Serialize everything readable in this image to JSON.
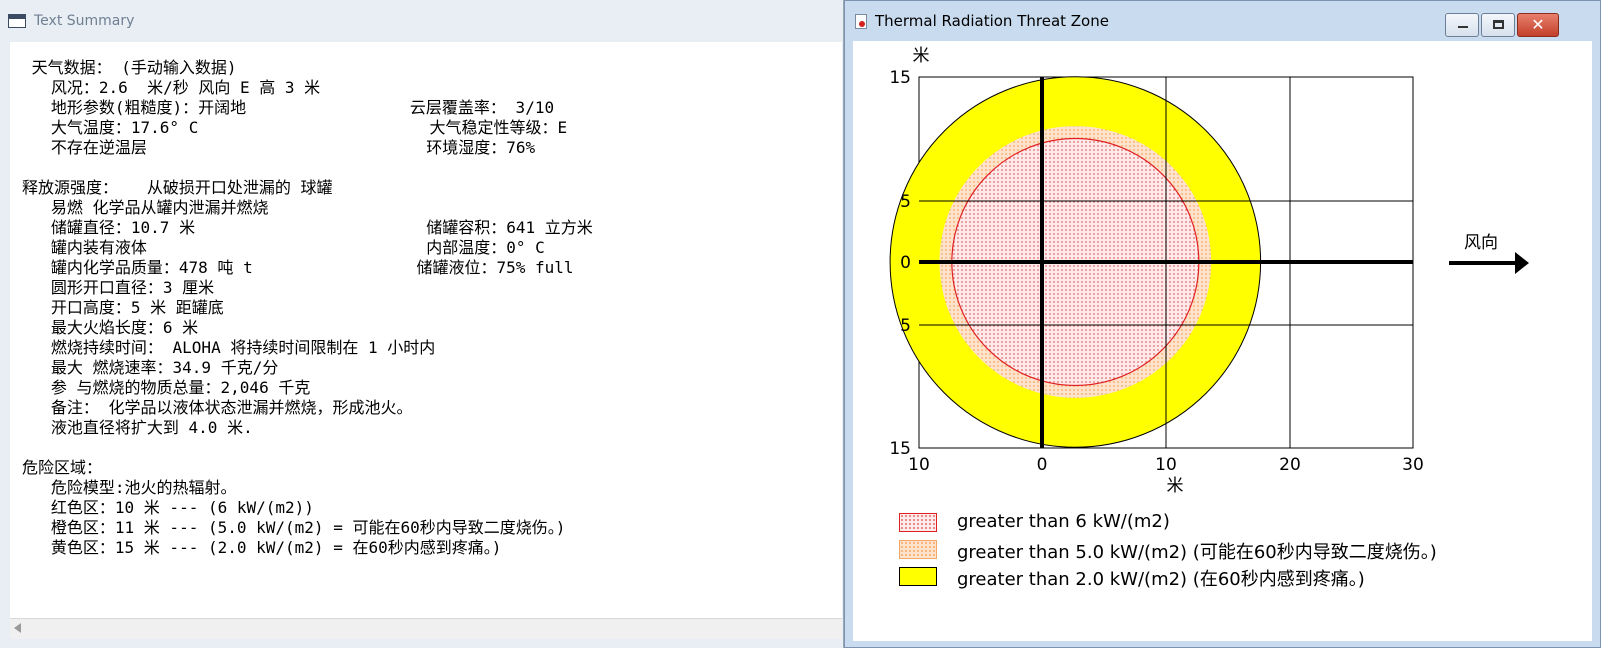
{
  "summary_window": {
    "title": "Text Summary",
    "text": " 天气数据： (手动输入数据)\n   风况：2.6  米/秒 风向 E 高 3 米\n   地形参数(粗糙度)：开阔地                 云层覆盖率： 3/10\n   大气温度：17.6° C                        大气稳定性等级：E\n   不存在逆温层                             环境湿度：76%\n\n释放源强度：   从破损开口处泄漏的 球罐\n   易燃 化学品从罐内泄漏并燃烧\n   储罐直径：10.7 米                        储罐容积：641 立方米\n   罐内装有液体                             内部温度：0° C\n   罐内化学品质量：478 吨 t                 储罐液位：75% full\n   圆形开口直径：3 厘米\n   开口高度：5 米 距罐底\n   最大火焰长度：6 米\n   燃烧持续时间： ALOHA 将持续时间限制在 1 小时内\n   最大 燃烧速率：34.9 千克/分\n   参 与燃烧的物质总量：2,046 千克\n   备注： 化学品以液体状态泄漏并燃烧，形成池火。\n   液池直径将扩大到 4.0 米.\n\n危险区域：\n   危险模型:池火的热辐射。\n   红色区：10 米 --- (6 kW/(m2))\n   橙色区：11 米 --- (5.0 kW/(m2) = 可能在60秒内导致二度烧伤。)\n   黄色区：15 米 --- (2.0 kW/(m2) = 在60秒内感到疼痛。)"
  },
  "threat_window": {
    "title": "Thermal Radiation Threat Zone",
    "buttons": {
      "close": "✕"
    }
  },
  "chart_data": {
    "type": "threat-zone",
    "x_ticks": [
      "10",
      "0",
      "10",
      "20",
      "30"
    ],
    "y_ticks": [
      "15",
      "5",
      "0",
      "5",
      "15"
    ],
    "x_unit": "米",
    "y_unit": "米",
    "wind_label": "风向",
    "zones": [
      {
        "name": "greater than 2.0 kW/(m2) (在60秒内感到疼痛。)",
        "radius": 15,
        "center_x": 2.7,
        "center_y": 0,
        "fill": "#ffff00"
      },
      {
        "name": "greater than 5.0 kW/(m2) (可能在60秒内导致二度烧伤。)",
        "radius": 11,
        "center_x": 2.7,
        "center_y": 0,
        "fill": "#f7bf90"
      },
      {
        "name": "greater than 6 kW/(m2)",
        "radius": 10,
        "center_x": 2.7,
        "center_y": 0,
        "fill": "#fdeaea",
        "stroke": "#e02020"
      }
    ],
    "legend": [
      {
        "label": "greater than 6 kW/(m2)",
        "style": "red-dots"
      },
      {
        "label": "greater than 5.0 kW/(m2) (可能在60秒内导致二度烧伤。)",
        "style": "orange-dots"
      },
      {
        "label": "greater than 2.0 kW/(m2) (在60秒内感到疼痛。)",
        "style": "yellow"
      }
    ]
  }
}
